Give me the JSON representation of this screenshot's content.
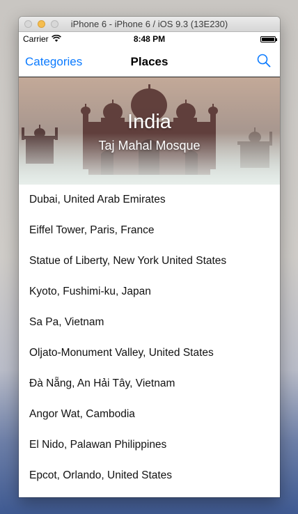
{
  "window": {
    "title": "iPhone 6 - iPhone 6 / iOS 9.3 (13E230)"
  },
  "statusbar": {
    "carrier": "Carrier",
    "time": "8:48 PM",
    "icons": [
      "wifi-icon",
      "battery-icon"
    ]
  },
  "navbar": {
    "back_label": "Categories",
    "title": "Places",
    "search_icon": "search-icon",
    "accent_color": "#0a7aff"
  },
  "hero": {
    "title": "India",
    "subtitle": "Taj Mahal Mosque"
  },
  "places": [
    "Dubai, United Arab Emirates",
    "Eiffel Tower, Paris, France",
    "Statue of Liberty, New York United States",
    "Kyoto, Fushimi-ku, Japan",
    "Sa Pa, Vietnam",
    "Oljato-Monument Valley, United States",
    "Đà Nẵng, An Hải Tây, Vietnam",
    "Angor Wat, Cambodia",
    "El Nido, Palawan Philippines",
    "Epcot, Orlando, United States"
  ]
}
